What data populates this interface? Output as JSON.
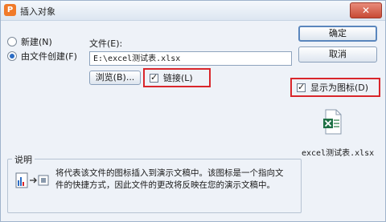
{
  "window": {
    "title": "插入对象",
    "app_icon_glyph": "P",
    "close_glyph": "✕"
  },
  "options": {
    "create_new": "新建(N)",
    "create_from_file": "由文件创建(F)"
  },
  "file": {
    "label": "文件(E):",
    "path": "E:\\excel测试表.xlsx"
  },
  "browse_label": "浏览(B)...",
  "link_label": "链接(L)",
  "display_as_icon_label": "显示为图标(D)",
  "buttons": {
    "ok": "确定",
    "cancel": "取消"
  },
  "icon_caption": "excel测试表.xlsx",
  "result": {
    "title": "说明",
    "text": "将代表该文件的图标插入到演示文稿中。该图标是一个指向文件的快捷方式，因此文件的更改将反映在您的演示文稿中。"
  },
  "colors": {
    "highlight": "#d9262b",
    "accent": "#2b6cc4",
    "excel_green": "#1e7145"
  },
  "icons": [
    "app-icon",
    "close-icon",
    "excel-file-icon",
    "result-icon"
  ]
}
